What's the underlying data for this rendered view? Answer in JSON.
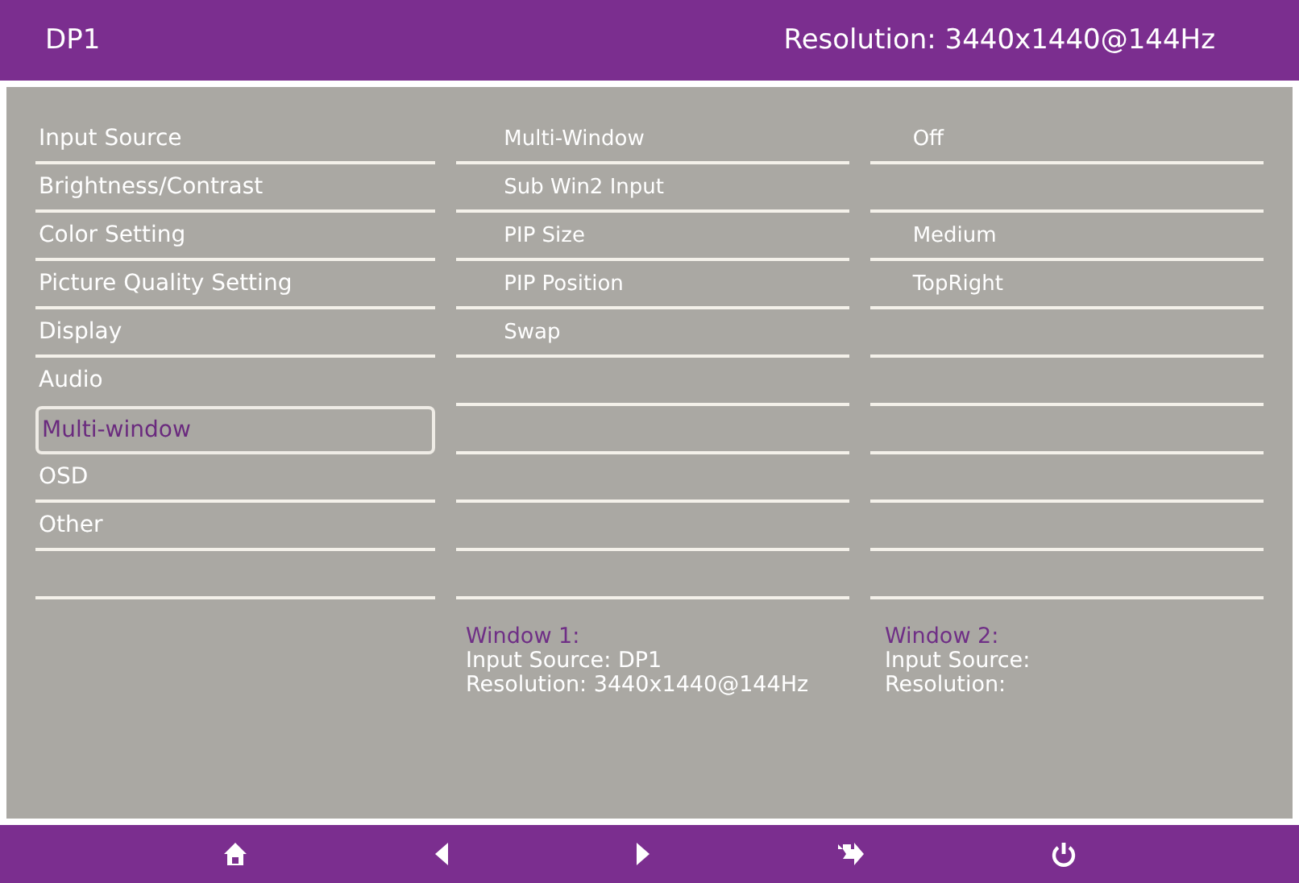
{
  "header": {
    "source": "DP1",
    "resolution": "Resolution: 3440x1440@144Hz"
  },
  "menu": [
    {
      "label": "Input Source",
      "selected": false
    },
    {
      "label": "Brightness/Contrast",
      "selected": false
    },
    {
      "label": "Color Setting",
      "selected": false
    },
    {
      "label": "Picture Quality Setting",
      "selected": false
    },
    {
      "label": "Display",
      "selected": false
    },
    {
      "label": "Audio",
      "selected": false
    },
    {
      "label": "Multi-window",
      "selected": true
    },
    {
      "label": "OSD",
      "selected": false
    },
    {
      "label": "Other",
      "selected": false
    }
  ],
  "submenu": [
    {
      "label": "Multi-Window",
      "value": "Off"
    },
    {
      "label": "Sub Win2 Input"
    },
    {
      "label": "PIP Size",
      "value": "Medium"
    },
    {
      "label": "PIP Position",
      "value": "TopRight"
    },
    {
      "label": "Swap"
    }
  ],
  "windows": [
    {
      "title": "Window 1:",
      "lines": [
        "Input Source: DP1",
        "Resolution: 3440x1440@144Hz"
      ]
    },
    {
      "title": "Window 2:",
      "lines": [
        "Input Source:",
        "Resolution:"
      ]
    }
  ],
  "footer": [
    {
      "kind": "home"
    },
    {
      "kind": "left"
    },
    {
      "kind": "right"
    },
    {
      "kind": "exit"
    },
    {
      "kind": "power"
    }
  ]
}
